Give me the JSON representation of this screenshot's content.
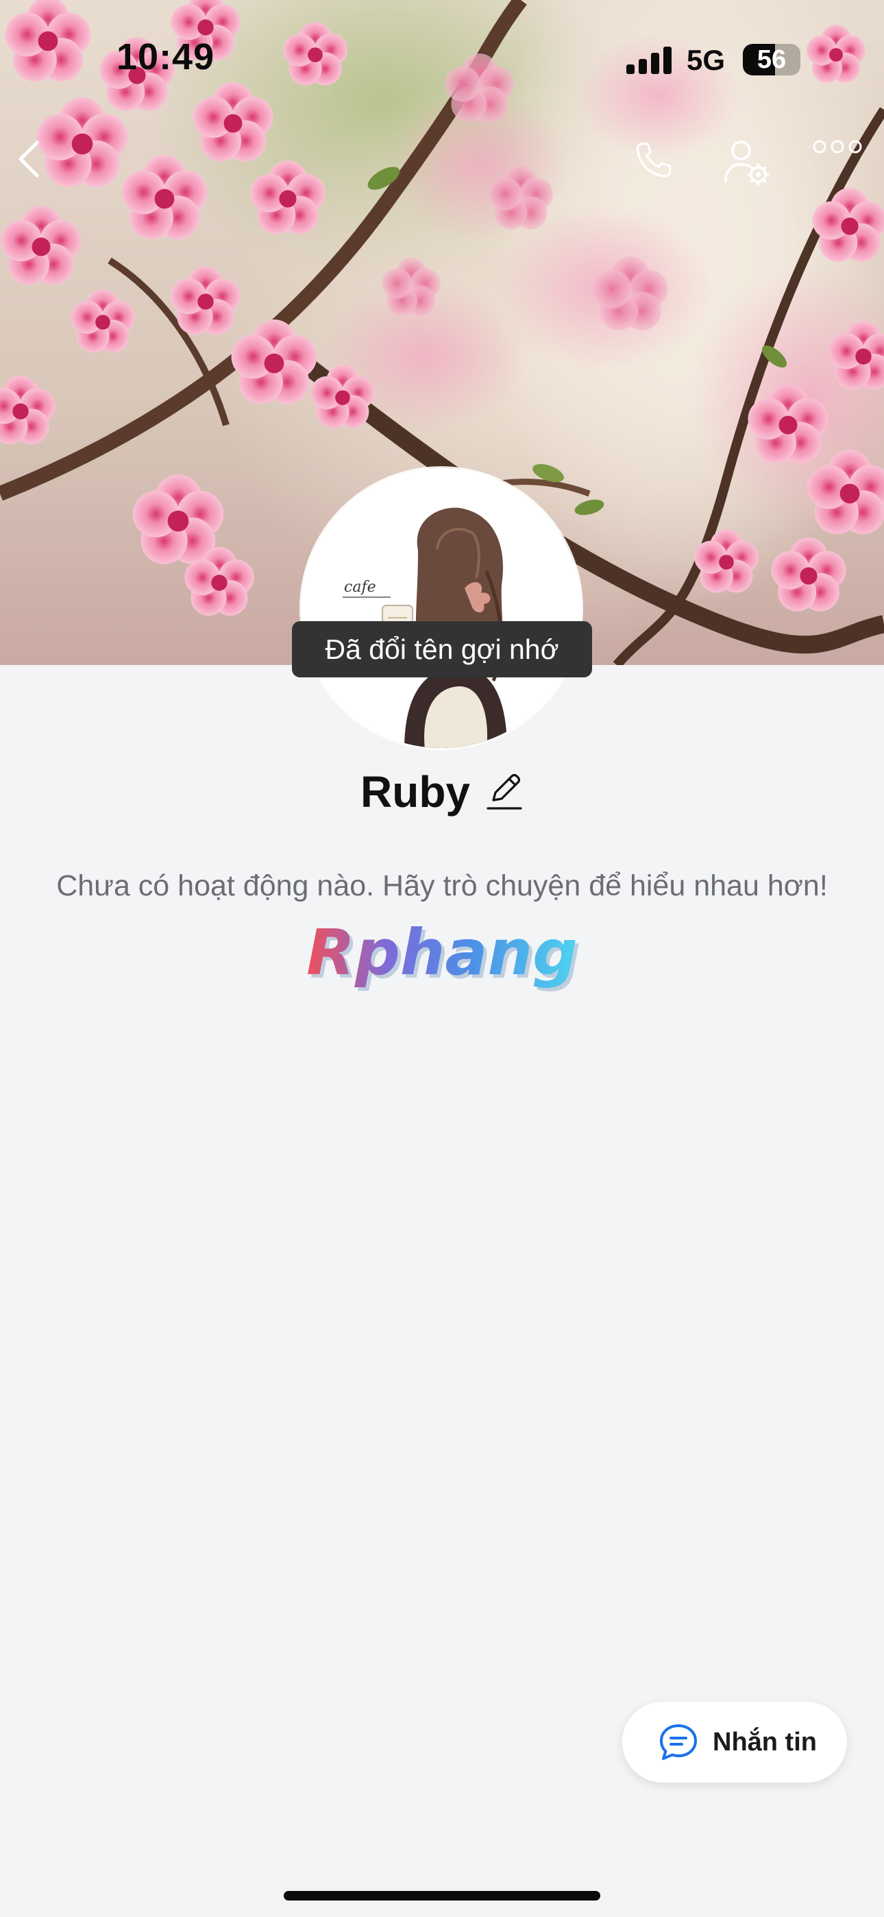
{
  "status_bar": {
    "time": "10:49",
    "network": "5G",
    "battery": "56",
    "battery_level_percent": 56
  },
  "nav": {
    "back_icon": "chevron-left-icon",
    "call_icon": "phone-icon",
    "settings_icon": "user-settings-icon",
    "more_icon": "more-dots-icon"
  },
  "toast": {
    "text": "Đã đổi tên gợi nhớ"
  },
  "profile": {
    "name": "Ruby",
    "edit_icon": "pencil-icon",
    "empty_activity": "Chưa có hoạt động nào. Hãy trò chuyện để hiểu nhau hơn!",
    "avatar_caption": "cafe"
  },
  "watermark": {
    "text": "Rphang"
  },
  "message_button": {
    "label": "Nhắn tin",
    "icon": "chat-bubble-icon"
  },
  "colors": {
    "background": "#f3f4f6",
    "toast_bg": "#333333",
    "accent_blue": "#1a73e8"
  }
}
